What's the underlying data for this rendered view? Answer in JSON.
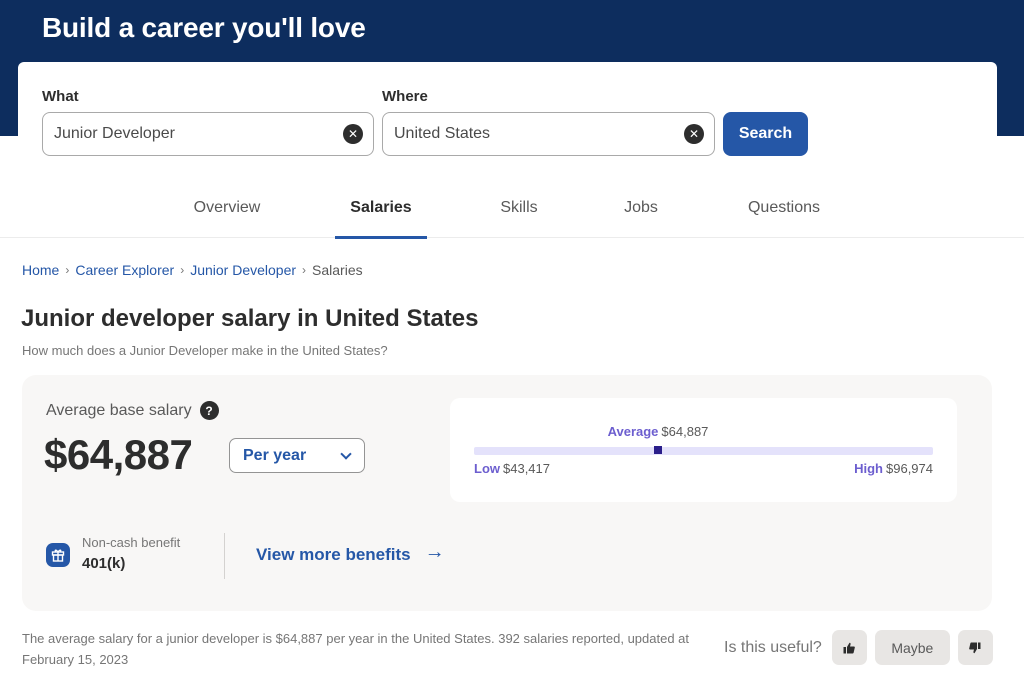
{
  "hero": {
    "title": "Build a career you'll love"
  },
  "search": {
    "what_label": "What",
    "what_value": "Junior Developer",
    "where_label": "Where",
    "where_value": "United States",
    "clear_glyph": "✕",
    "button_label": "Search"
  },
  "tabs": [
    {
      "label": "Overview",
      "active": false
    },
    {
      "label": "Salaries",
      "active": true
    },
    {
      "label": "Skills",
      "active": false
    },
    {
      "label": "Jobs",
      "active": false
    },
    {
      "label": "Questions",
      "active": false
    }
  ],
  "breadcrumb": {
    "separator": "›",
    "items": [
      "Home",
      "Career Explorer",
      "Junior Developer",
      "Salaries"
    ]
  },
  "page": {
    "title": "Junior developer salary in United States",
    "subtitle": "How much does a Junior Developer make in the United States?"
  },
  "salary": {
    "label": "Average base salary",
    "help_glyph": "?",
    "value": "$64,887",
    "period": "Per year",
    "range": {
      "average_label": "Average",
      "average_value": "$64,887",
      "low_label": "Low",
      "low_value": "$43,417",
      "high_label": "High",
      "high_value": "$96,974",
      "low": 43417,
      "average": 64887,
      "high": 96974
    },
    "benefit_label": "Non-cash benefit",
    "benefit_value": "401(k)",
    "more_benefits": "View more benefits",
    "arrow_glyph": "→"
  },
  "footnote": {
    "line": "The average salary for a junior developer is $64,887 per year in the United States.  392 salaries reported, updated at February 15, 2023"
  },
  "feedback": {
    "question": "Is this useful?",
    "maybe_label": "Maybe"
  },
  "colors": {
    "brand_navy": "#0d2d5e",
    "brand_blue": "#2557a7",
    "range_accent": "#6c5ecf",
    "range_marker": "#2a1e8a"
  }
}
